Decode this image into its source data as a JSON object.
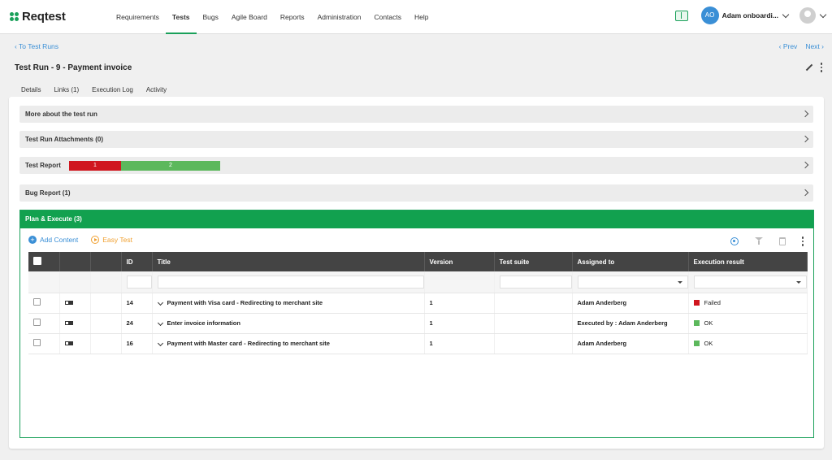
{
  "app": {
    "name": "Reqtest",
    "brand_color": "#1aa05a"
  },
  "nav": {
    "items": [
      "Requirements",
      "Tests",
      "Bugs",
      "Agile Board",
      "Reports",
      "Administration",
      "Contacts",
      "Help"
    ],
    "active": "Tests"
  },
  "user": {
    "initials": "AO",
    "name": "Adam onboardi..."
  },
  "breadcrumb": {
    "back": "To Test Runs",
    "prev": "Prev",
    "next": "Next"
  },
  "run": {
    "title": "Test Run - 9 - Payment invoice"
  },
  "tabs": [
    "Details",
    "Links (1)",
    "Execution Log",
    "Activity"
  ],
  "sections": {
    "more": "More about the test run",
    "attachments": "Test Run Attachments (0)",
    "report": "Test Report",
    "bugs": "Bug Report (1)"
  },
  "test_report_bar": {
    "failed": 1,
    "ok": 2,
    "failed_color": "#d0161f",
    "ok_color": "#5cb85c"
  },
  "plan": {
    "header": "Plan & Execute (3)",
    "add_content": "Add Content",
    "easy_test": "Easy Test"
  },
  "table": {
    "columns": [
      "ID",
      "Title",
      "Version",
      "Test suite",
      "Assigned to",
      "Execution result"
    ],
    "rows": [
      {
        "id": "14",
        "title": "Payment with Visa card - Redirecting to merchant site",
        "version": "1",
        "suite": "",
        "assigned": "Adam Anderberg",
        "result": "Failed",
        "result_color": "#d0161f"
      },
      {
        "id": "24",
        "title": "Enter invoice information",
        "version": "1",
        "suite": "",
        "assigned": "Executed by : Adam Anderberg",
        "result": "OK",
        "result_color": "#5cb85c"
      },
      {
        "id": "16",
        "title": "Payment with Master card - Redirecting to merchant site",
        "version": "1",
        "suite": "",
        "assigned": "Adam Anderberg",
        "result": "OK",
        "result_color": "#5cb85c"
      }
    ]
  }
}
